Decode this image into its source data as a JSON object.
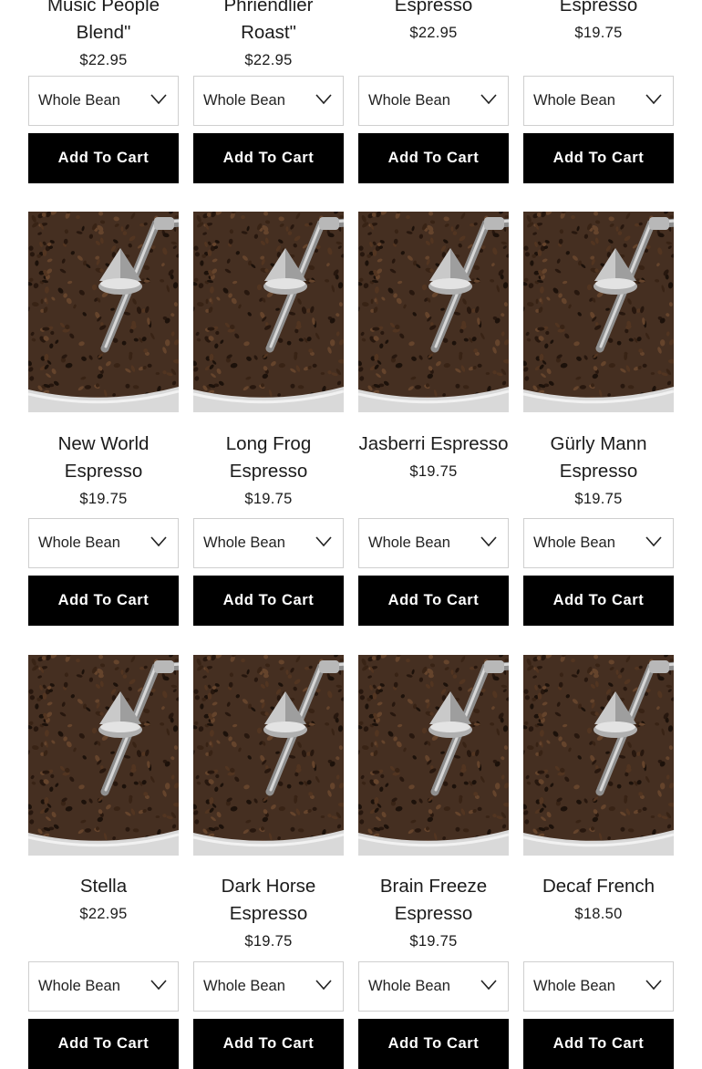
{
  "rows": [
    {
      "products": [
        {
          "name": "Music People Blend\"",
          "name_lines": [
            "Music People",
            "Blend\""
          ],
          "price": "$22.95",
          "option": "Whole Bean",
          "button": "Add To Cart"
        },
        {
          "name": "Phriendlier Roast\"",
          "name_lines": [
            "Phriendlier",
            "Roast\""
          ],
          "price": "$22.95",
          "option": "Whole Bean",
          "button": "Add To Cart"
        },
        {
          "name": "Espresso",
          "name_lines": [
            "Espresso"
          ],
          "price": "$22.95",
          "option": "Whole Bean",
          "button": "Add To Cart"
        },
        {
          "name": "Espresso",
          "name_lines": [
            "Espresso"
          ],
          "price": "$19.75",
          "option": "Whole Bean",
          "button": "Add To Cart"
        }
      ]
    },
    {
      "products": [
        {
          "name": "New World Espresso",
          "name_lines": [
            "New World",
            "Espresso"
          ],
          "price": "$19.75",
          "option": "Whole Bean",
          "button": "Add To Cart"
        },
        {
          "name": "Long Frog Espresso",
          "name_lines": [
            "Long Frog",
            "Espresso"
          ],
          "price": "$19.75",
          "option": "Whole Bean",
          "button": "Add To Cart"
        },
        {
          "name": "Jasberri Espresso",
          "name_lines": [
            "Jasberri Espresso"
          ],
          "price": "$19.75",
          "option": "Whole Bean",
          "button": "Add To Cart"
        },
        {
          "name": "Gürly Mann Espresso",
          "name_lines": [
            "Gürly Mann",
            "Espresso"
          ],
          "price": "$19.75",
          "option": "Whole Bean",
          "button": "Add To Cart"
        }
      ]
    },
    {
      "products": [
        {
          "name": "Stella",
          "name_lines": [
            "Stella"
          ],
          "price": "$22.95",
          "option": "Whole Bean",
          "button": "Add To Cart"
        },
        {
          "name": "Dark Horse Espresso",
          "name_lines": [
            "Dark Horse",
            "Espresso"
          ],
          "price": "$19.75",
          "option": "Whole Bean",
          "button": "Add To Cart"
        },
        {
          "name": "Brain Freeze Espresso",
          "name_lines": [
            "Brain Freeze",
            "Espresso"
          ],
          "price": "$19.75",
          "option": "Whole Bean",
          "button": "Add To Cart"
        },
        {
          "name": "Decaf French",
          "name_lines": [
            "Decaf French"
          ],
          "price": "$18.50",
          "option": "Whole Bean",
          "button": "Add To Cart"
        }
      ]
    }
  ],
  "icons": {
    "select_arrow": "chevron-down-icon"
  }
}
